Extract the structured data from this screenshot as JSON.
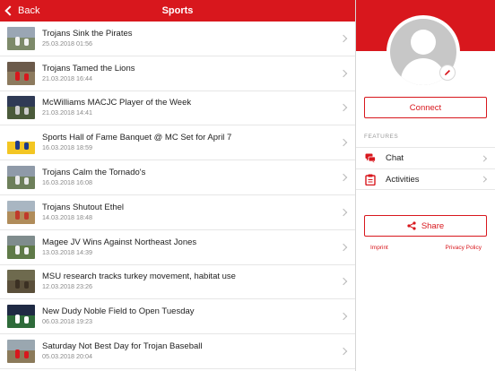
{
  "topbar": {
    "back_label": "Back",
    "title": "Sports"
  },
  "articles": [
    {
      "headline": "Trojans Sink the Pirates",
      "date": "25.03.2018 01:56",
      "thumb": [
        "#9aa6b4",
        "#7d8a6a",
        "#f2f2f2"
      ]
    },
    {
      "headline": "Trojans Tamed the Lions",
      "date": "21.03.2018 16:44",
      "thumb": [
        "#6b5a4a",
        "#8c7a5e",
        "#d8171d"
      ]
    },
    {
      "headline": "McWilliams MACJC Player of the Week",
      "date": "21.03.2018 14:41",
      "thumb": [
        "#2f3a55",
        "#4a5a3a",
        "#cccccc"
      ]
    },
    {
      "headline": "Sports Hall of Fame Banquet @ MC Set for April 7",
      "date": "16.03.2018 18:59",
      "thumb": [
        "#ffffff",
        "#f3c623",
        "#1e3a8a"
      ]
    },
    {
      "headline": "Trojans Calm the Tornado's",
      "date": "16.03.2018 16:08",
      "thumb": [
        "#8f9aa8",
        "#6d7f5a",
        "#e8e8e8"
      ]
    },
    {
      "headline": "Trojans Shutout Ethel",
      "date": "14.03.2018 18:48",
      "thumb": [
        "#a9b6c2",
        "#b08c5a",
        "#c0392b"
      ]
    },
    {
      "headline": "Magee JV Wins Against Northeast Jones",
      "date": "13.03.2018 14:39",
      "thumb": [
        "#7f8c8d",
        "#5f7a48",
        "#f2f2f2"
      ]
    },
    {
      "headline": "MSU research tracks turkey movement, habitat use",
      "date": "12.03.2018 23:26",
      "thumb": [
        "#6e6a4e",
        "#5a4f3a",
        "#3b3023"
      ]
    },
    {
      "headline": "New Dudy Noble Field to Open Tuesday",
      "date": "06.03.2018 19:23",
      "thumb": [
        "#1f2a44",
        "#2e6b3a",
        "#ffffff"
      ]
    },
    {
      "headline": "Saturday Not Best Day for Trojan Baseball",
      "date": "05.03.2018 20:04",
      "thumb": [
        "#9aa7b0",
        "#8b7a5a",
        "#d8171d"
      ]
    }
  ],
  "profile": {
    "avatar_icon": "user-placeholder-icon",
    "edit_icon": "pencil-icon",
    "connect_label": "Connect"
  },
  "features": {
    "section_label": "FEATURES",
    "items": [
      {
        "label": "Chat",
        "icon": "chat-bubbles-icon"
      },
      {
        "label": "Activities",
        "icon": "clipboard-icon"
      }
    ]
  },
  "share": {
    "label": "Share",
    "icon": "share-icon"
  },
  "footer": {
    "imprint": "Imprint",
    "privacy": "Privacy Policy"
  },
  "colors": {
    "accent": "#d8171d"
  }
}
